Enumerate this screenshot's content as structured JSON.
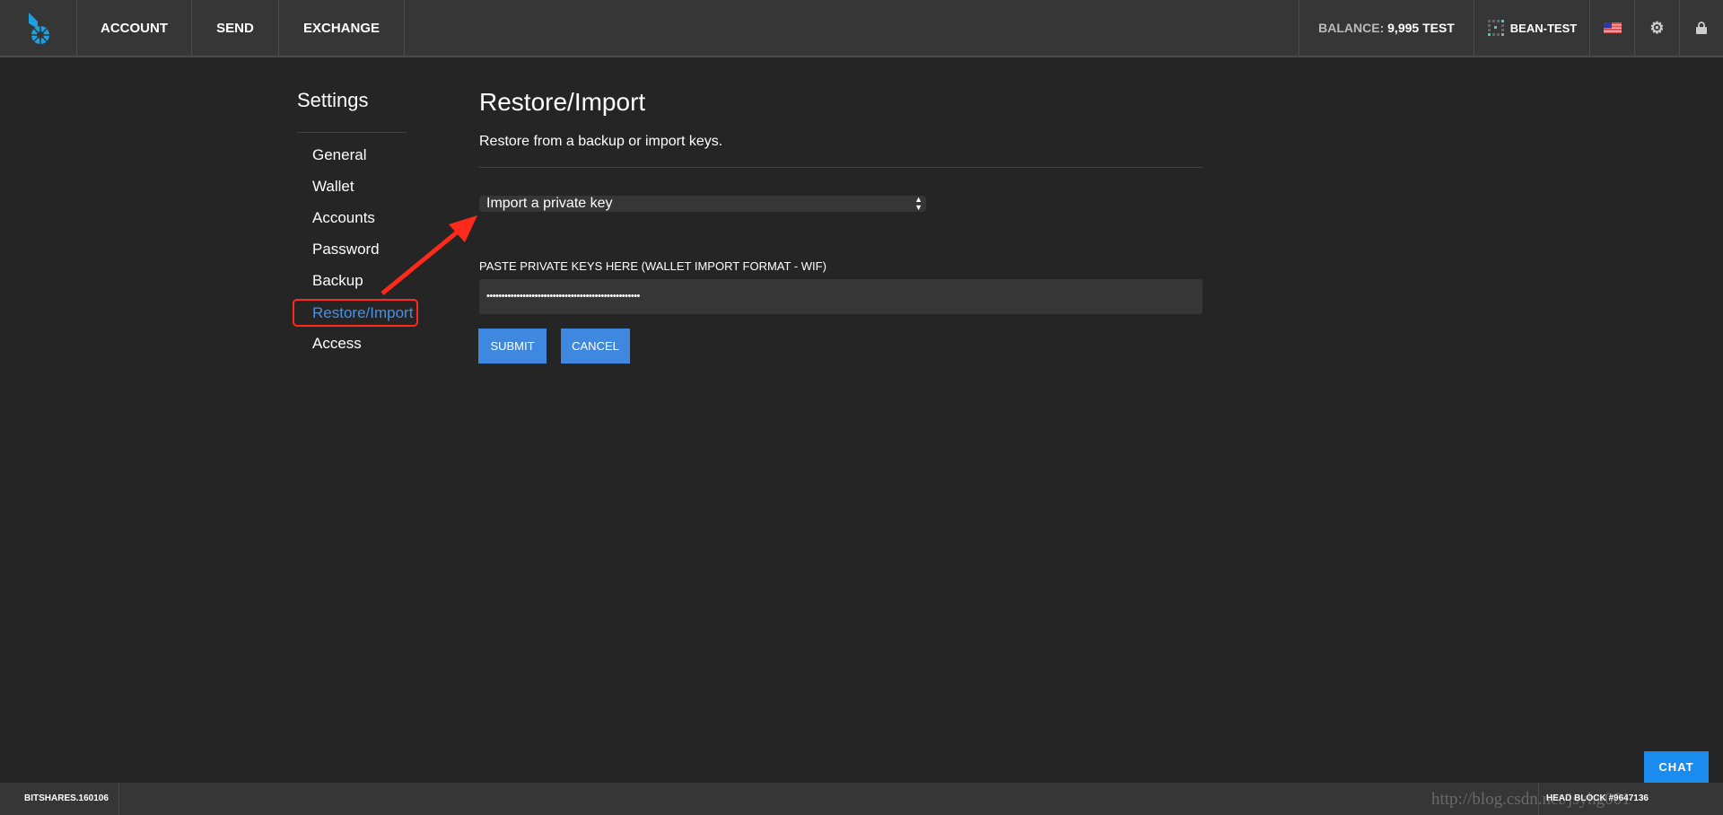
{
  "header": {
    "nav": [
      "ACCOUNT",
      "SEND",
      "EXCHANGE"
    ],
    "balance_label": "BALANCE:",
    "balance_value": "9,995 TEST",
    "account_name": "BEAN-TEST"
  },
  "sidebar": {
    "title": "Settings",
    "items": [
      "General",
      "Wallet",
      "Accounts",
      "Password",
      "Backup",
      "Restore/Import",
      "Access"
    ],
    "active": "Restore/Import"
  },
  "main": {
    "title": "Restore/Import",
    "subtitle": "Restore from a backup or import keys.",
    "select_value": "Import a private key",
    "field_label": "PASTE PRIVATE KEYS HERE (WALLET IMPORT FORMAT - WIF)",
    "field_value": "•••••••••••••••••••••••••••••••••••••••••••••••••••",
    "submit": "SUBMIT",
    "cancel": "CANCEL"
  },
  "chat": "CHAT",
  "footer": {
    "version": "BITSHARES.160106",
    "head_block": "HEAD BLOCK #9647136"
  },
  "watermark": "http://blog.csdn.net/jsyhg001",
  "colors": {
    "accent": "#3f88e0",
    "logo": "#1ba1e2",
    "annotation": "#ff2a1a"
  }
}
